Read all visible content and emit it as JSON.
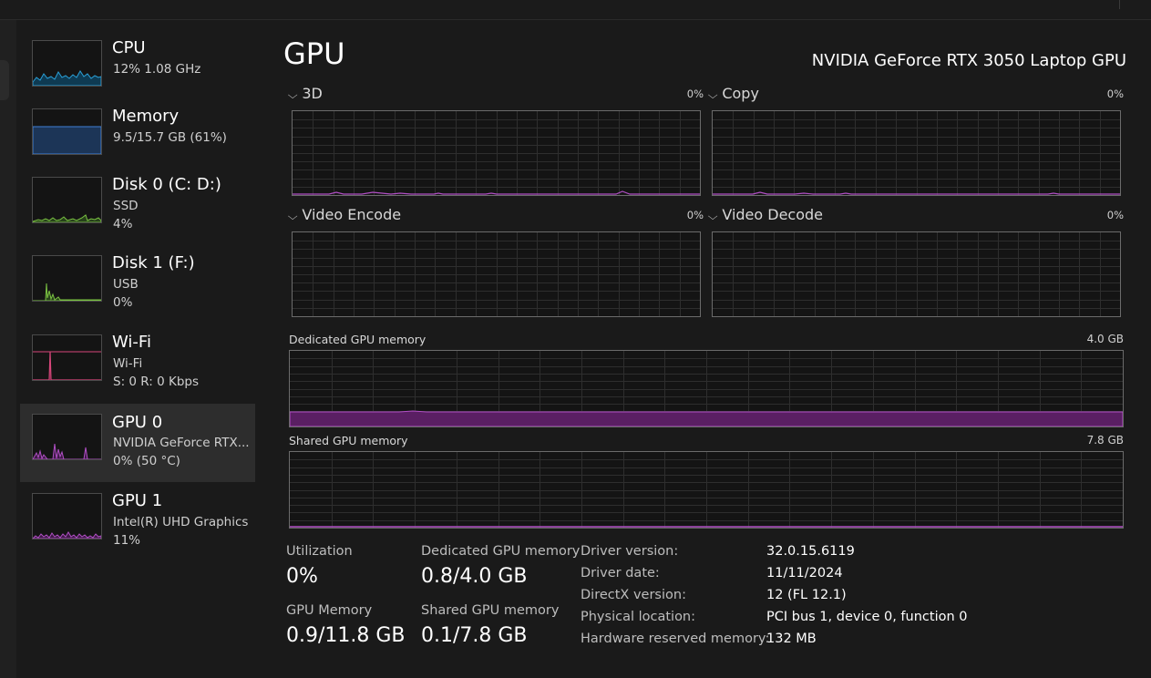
{
  "sidebar": {
    "items": [
      {
        "title": "CPU",
        "sub1": "12%  1.08 GHz",
        "sub2": "",
        "color": "#2a9fd6"
      },
      {
        "title": "Memory",
        "sub1": "9.5/15.7 GB (61%)",
        "sub2": "",
        "color": "#3f7fd6"
      },
      {
        "title": "Disk 0 (C: D:)",
        "sub1": "SSD",
        "sub2": "4%",
        "color": "#7ac142"
      },
      {
        "title": "Disk 1 (F:)",
        "sub1": "USB",
        "sub2": "0%",
        "color": "#7ac142"
      },
      {
        "title": "Wi-Fi",
        "sub1": "Wi-Fi",
        "sub2": "S: 0 R: 0 Kbps",
        "color": "#d6467a"
      },
      {
        "title": "GPU 0",
        "sub1": "NVIDIA GeForce RTX...",
        "sub2": "0%  (50 °C)",
        "color": "#b14fc5",
        "selected": true
      },
      {
        "title": "GPU 1",
        "sub1": "Intel(R) UHD Graphics",
        "sub2": "11%",
        "color": "#b14fc5"
      }
    ]
  },
  "header": {
    "title": "GPU",
    "device": "NVIDIA GeForce RTX 3050 Laptop GPU"
  },
  "engines": [
    {
      "label": "3D",
      "pct": "0%"
    },
    {
      "label": "Copy",
      "pct": "0%"
    },
    {
      "label": "Video Encode",
      "pct": "0%"
    },
    {
      "label": "Video Decode",
      "pct": "0%"
    }
  ],
  "memory_graphs": {
    "dedicated": {
      "label": "Dedicated GPU memory",
      "max": "4.0 GB"
    },
    "shared": {
      "label": "Shared GPU memory",
      "max": "7.8 GB"
    }
  },
  "stats": {
    "utilization": {
      "label": "Utilization",
      "value": "0%"
    },
    "dedicated": {
      "label": "Dedicated GPU memory",
      "value": "0.8/4.0 GB"
    },
    "gpu_memory": {
      "label": "GPU Memory",
      "value": "0.9/11.8 GB"
    },
    "shared": {
      "label": "Shared GPU memory",
      "value": "0.1/7.8 GB"
    }
  },
  "info": [
    {
      "key": "Driver version:",
      "value": "32.0.15.6119"
    },
    {
      "key": "Driver date:",
      "value": "11/11/2024"
    },
    {
      "key": "DirectX version:",
      "value": "12 (FL 12.1)"
    },
    {
      "key": "Physical location:",
      "value": "PCI bus 1, device 0, function 0"
    },
    {
      "key": "Hardware reserved memory:",
      "value": "132 MB"
    }
  ],
  "colors": {
    "gpu_accent": "#b14fc5",
    "memory_fill": "#5a1f63"
  }
}
